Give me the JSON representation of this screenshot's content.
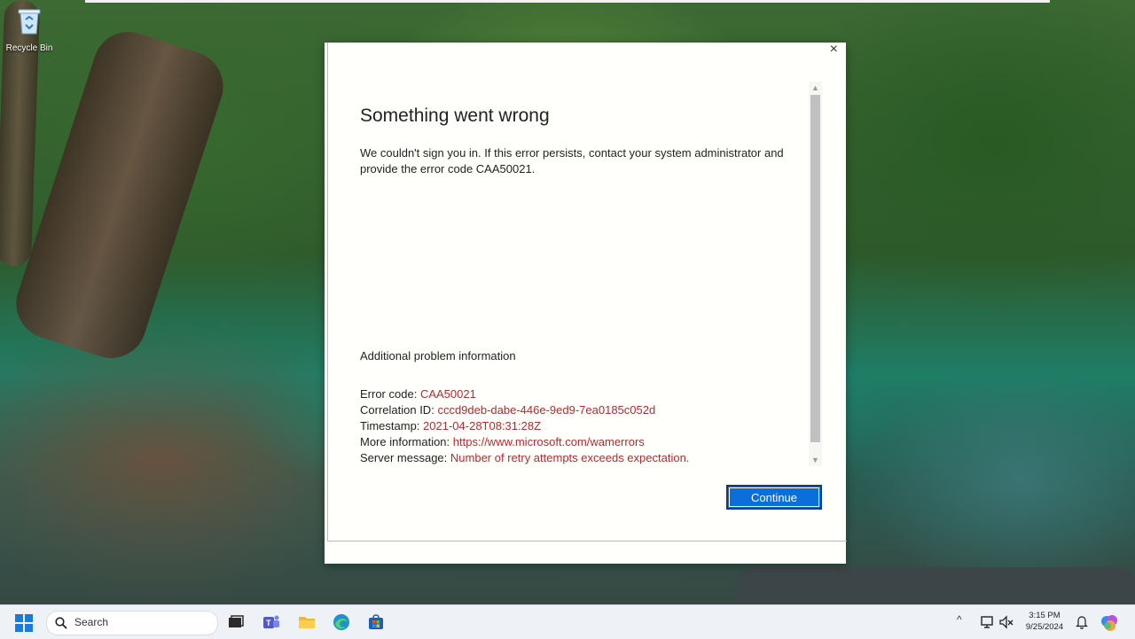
{
  "desktop": {
    "recycle_bin_label": "Recycle Bin"
  },
  "dialog": {
    "close_glyph": "×",
    "title": "Something went wrong",
    "message": "We couldn't sign you in. If this error persists, contact your system administrator and provide the error code CAA50021.",
    "additional_heading": "Additional problem information",
    "details": {
      "error_code_label": "Error code:",
      "error_code_value": "CAA50021",
      "correlation_label": "Correlation ID:",
      "correlation_value": "cccd9deb-dabe-446e-9ed9-7ea0185c052d",
      "timestamp_label": "Timestamp:",
      "timestamp_value": "2021-04-28T08:31:28Z",
      "more_info_label": "More information:",
      "more_info_value": "https://www.microsoft.com/wamerrors",
      "server_message_label": "Server message:",
      "server_message_value": "Number of retry attempts exceeds expectation."
    },
    "continue_label": "Continue",
    "accent_color": "#0a6fd8",
    "error_value_color": "#b22d2d"
  },
  "taskbar": {
    "search_placeholder": "Search",
    "apps": [
      "task-view-icon",
      "teams-icon",
      "file-explorer-icon",
      "edge-icon",
      "store-icon"
    ],
    "tray_icons": [
      "show-hidden-icons-chevron",
      "display-icon",
      "speaker-muted-icon"
    ],
    "time": "3:15 PM",
    "date": "9/25/2024",
    "tray_chevron_glyph": "^"
  }
}
